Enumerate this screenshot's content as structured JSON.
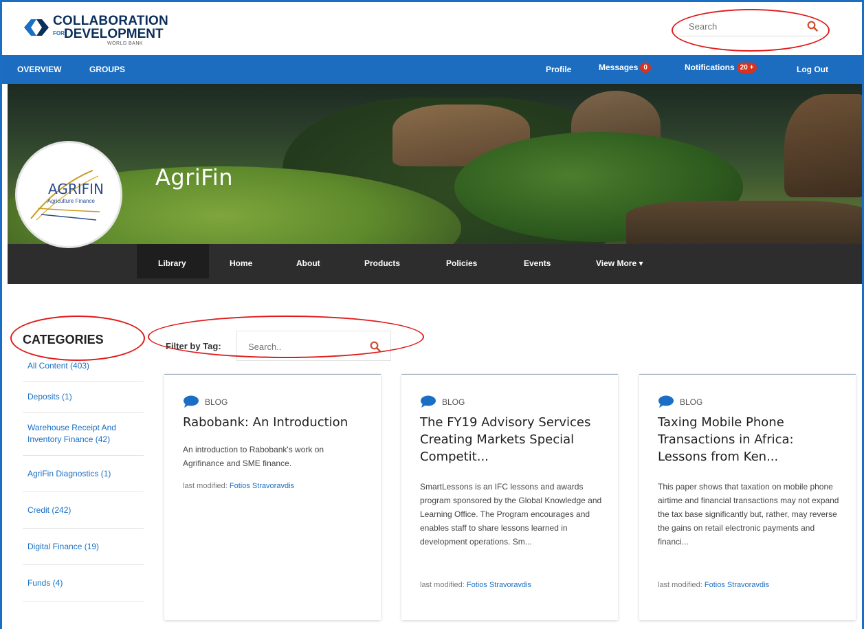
{
  "header": {
    "logo_line1": "COLLABORATION",
    "logo_for": "FOR",
    "logo_line2": "DEVELOPMENT",
    "logo_line3": "WORLD BANK",
    "search_placeholder": "Search"
  },
  "nav": {
    "left": [
      {
        "label": "OVERVIEW"
      },
      {
        "label": "GROUPS"
      }
    ],
    "profile": "Profile",
    "messages": "Messages",
    "messages_count": "0",
    "notifications": "Notifications",
    "notifications_count": "20 +",
    "logout": "Log Out"
  },
  "group": {
    "name": "AgriFin",
    "logo_main": "AGRIFIN",
    "logo_sub": "Agriculture Finance"
  },
  "subnav": [
    {
      "label": "Library",
      "active": true
    },
    {
      "label": "Home"
    },
    {
      "label": "About"
    },
    {
      "label": "Products"
    },
    {
      "label": "Policies"
    },
    {
      "label": "Events"
    },
    {
      "label": "View More ▾"
    }
  ],
  "sidebar": {
    "title": "CATEGORIES",
    "items": [
      {
        "label": "All Content (403)"
      },
      {
        "label": "Deposits (1)"
      },
      {
        "label": "Warehouse Receipt And Inventory Finance (42)"
      },
      {
        "label": "AgriFin Diagnostics (1)"
      },
      {
        "label": "Credit (242)"
      },
      {
        "label": "Digital Finance (19)"
      },
      {
        "label": "Funds (4)"
      }
    ]
  },
  "filter": {
    "label": "Filter by Tag:",
    "placeholder": "Search.."
  },
  "cards": [
    {
      "type": "BLOG",
      "title": "Rabobank: An Introduction",
      "desc": "An introduction to Rabobank's work on Agrifinance and SME finance.",
      "modified_label": "last modified:",
      "author": "Fotios Stravoravdis"
    },
    {
      "type": "BLOG",
      "title": "The FY19 Advisory Services Creating Markets Special Competit...",
      "desc": "SmartLessons is an IFC lessons and awards program sponsored by the Global Knowledge and Learning Office. The Program encourages and enables staff to share lessons learned in development operations. Sm...",
      "modified_label": "last modified:",
      "author": "Fotios Stravoravdis"
    },
    {
      "type": "BLOG",
      "title": "Taxing Mobile Phone Transactions in Africa: Lessons from Ken...",
      "desc": "This paper shows that taxation on mobile phone airtime and financial transactions may not expand the tax base significantly but, rather, may reverse the gains on retail electronic payments and financi...",
      "modified_label": "last modified:",
      "author": "Fotios Stravoravdis"
    }
  ],
  "colors": {
    "nav_blue": "#1c6cbf",
    "subnav_dark": "#2d2d2d",
    "link_blue": "#1a6fc4",
    "badge_red": "#d6321f",
    "highlight_red": "#e01b1b"
  }
}
